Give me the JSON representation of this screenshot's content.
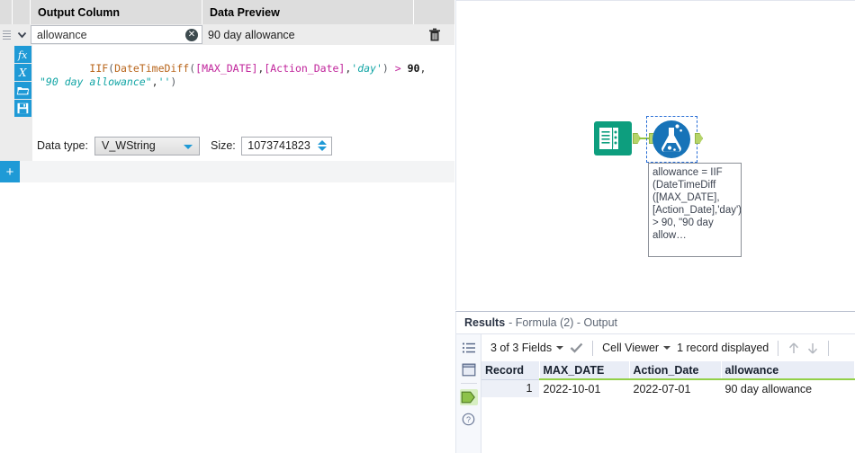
{
  "config_panel": {
    "columns": {
      "output_column": "Output Column",
      "data_preview": "Data Preview"
    },
    "row": {
      "output_name_value": "allowance",
      "output_name_placeholder": "",
      "data_preview_value": "90 day allowance"
    },
    "formula": {
      "tokens": [
        {
          "t": "IIF",
          "c": "fn"
        },
        {
          "t": "(",
          "c": "par"
        },
        {
          "t": "DateTimeDiff",
          "c": "fn"
        },
        {
          "t": "(",
          "c": "par"
        },
        {
          "t": "[MAX_DATE]",
          "c": "fld"
        },
        {
          "t": ",",
          "c": "com"
        },
        {
          "t": "[Action_Date]",
          "c": "fld"
        },
        {
          "t": ",",
          "c": "com"
        },
        {
          "t": "'day'",
          "c": "str"
        },
        {
          "t": ")",
          "c": "par"
        },
        {
          "t": " > ",
          "c": "op"
        },
        {
          "t": "90",
          "c": "num"
        },
        {
          "t": ",  ",
          "c": "com"
        },
        {
          "t": "\"90 day allowance\"",
          "c": "str"
        },
        {
          "t": ",",
          "c": "com"
        },
        {
          "t": "''",
          "c": "str"
        },
        {
          "t": ")",
          "c": "par"
        }
      ],
      "plain": "IIF(DateTimeDiff([MAX_DATE],[Action_Date],'day') > 90,  \"90 day allowance\",'')"
    },
    "data_type": {
      "label": "Data type:",
      "selected": "V_WString"
    },
    "size": {
      "label": "Size:",
      "value": "1073741823"
    },
    "add_button_label": "+",
    "icons": {
      "grip": "drag-handle-icon",
      "caret": "chevron-down-icon",
      "clear": "clear-field-icon",
      "trash": "delete-row-icon",
      "fx": "function-icon",
      "x": "variable-icon",
      "open": "open-folder-icon",
      "save": "save-icon"
    }
  },
  "canvas": {
    "nodes": [
      {
        "name": "Input Data",
        "icon": "input-data-icon",
        "selected": false
      },
      {
        "name": "Formula",
        "icon": "formula-flask-icon",
        "selected": true
      }
    ],
    "annotation_text": "allowance = IIF (DateTimeDiff ([MAX_DATE], [Action_Date],'day') > 90, \"90 day allow…"
  },
  "results": {
    "title_main": "Results",
    "title_sub": "- Formula (2) - Output",
    "toolbar": {
      "fields_selector": "3 of 3 Fields",
      "check_icon": "checkmark-icon",
      "viewer_selector": "Cell Viewer",
      "record_count": "1 record displayed",
      "up_icon": "arrow-up-icon",
      "down_icon": "arrow-down-icon"
    },
    "rail_icons": [
      {
        "name": "list-view-icon",
        "active": false
      },
      {
        "name": "window-view-icon",
        "active": false
      },
      {
        "name": "output-connection-icon",
        "active": true
      },
      {
        "name": "help-icon",
        "active": false
      }
    ],
    "table": {
      "headers": [
        "Record",
        "MAX_DATE",
        "Action_Date",
        "allowance"
      ],
      "rows": [
        {
          "record": "1",
          "max_date": "2022-10-01",
          "action_date": "2022-07-01",
          "allowance": "90 day allowance"
        }
      ]
    }
  },
  "colors": {
    "accent_blue": "#1f9ad6",
    "node_green": "#0d9e7e",
    "node_blue": "#1773b8",
    "port_green": "#b5d469",
    "header_underline": "#93d048"
  }
}
